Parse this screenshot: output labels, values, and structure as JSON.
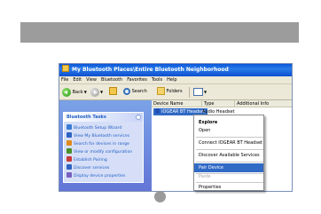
{
  "window": {
    "title": "My Bluetooth Places\\Entire Bluetooth Neighborhood"
  },
  "menu": [
    "File",
    "Edit",
    "View",
    "Bluetooth",
    "Favorites",
    "Tools",
    "Help"
  ],
  "toolbar": {
    "back_label": "Back",
    "search_label": "Search",
    "folders_label": "Folders"
  },
  "tasks": {
    "heading": "Bluetooth Tasks",
    "items": [
      {
        "label": "Bluetooth Setup Wizard",
        "icon": "wizard-icon",
        "color": "#3a7bd5"
      },
      {
        "label": "View My Bluetooth services",
        "icon": "services-icon",
        "color": "#2f62c2"
      },
      {
        "label": "Search for devices in range",
        "icon": "search-devices-icon",
        "color": "#e08a1e"
      },
      {
        "label": "View or modify configuration",
        "icon": "configuration-icon",
        "color": "#4a8f2a"
      },
      {
        "label": "Establish Pairing",
        "icon": "pairing-icon",
        "color": "#c73a3a"
      },
      {
        "label": "Discover services",
        "icon": "discover-icon",
        "color": "#2f62c2"
      },
      {
        "label": "Display device properties",
        "icon": "properties-icon",
        "color": "#7a5fc0"
      }
    ]
  },
  "columns": {
    "name": "Device Name",
    "type": "Type",
    "info": "Additional Info"
  },
  "device": {
    "name": "IOGEAR BT Headset",
    "type": "Audio Headset"
  },
  "context_menu": {
    "items": [
      {
        "label": "Explore",
        "style": "bold"
      },
      {
        "label": "Open",
        "style": "normal"
      },
      {
        "label": "Connect IOGEAR BT Headset",
        "style": "normal"
      },
      {
        "label": "Discover Available Services",
        "style": "normal"
      },
      {
        "label": "Pair Device",
        "style": "selected"
      },
      {
        "label": "Paste",
        "style": "disabled"
      },
      {
        "label": "Properties",
        "style": "normal"
      }
    ]
  },
  "colors": {
    "band": "#9c9c9c",
    "titlebar": "#0a56d8",
    "selection": "#316ac5",
    "task_link": "#215dc6"
  }
}
